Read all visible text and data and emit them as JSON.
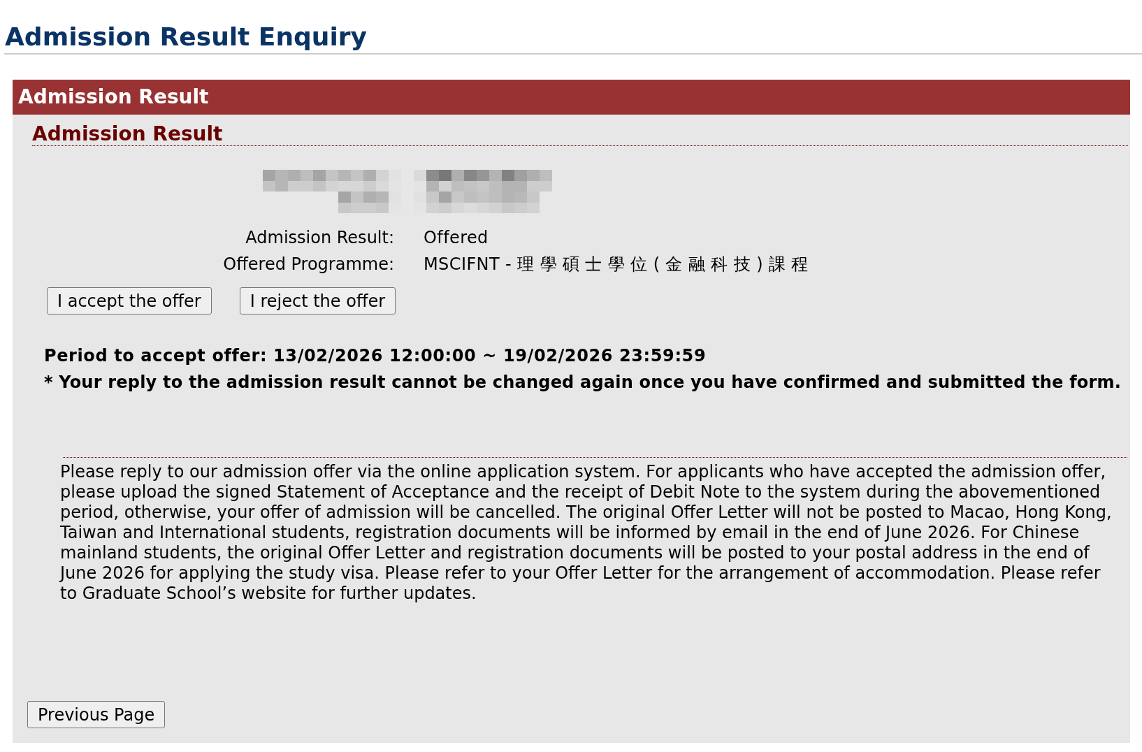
{
  "page_title": "Admission Result Enquiry",
  "panel": {
    "title": "Admission Result",
    "section_heading": "Admission Result",
    "details": [
      {
        "label": "Admission Result:",
        "value": "Offered"
      },
      {
        "label": "Offered Programme:",
        "value": "MSCIFNT - 理 學 碩 士 學 位 ( 金 融 科 技 ) 課 程"
      }
    ],
    "actions": [
      "I accept the offer",
      "I reject the offer"
    ],
    "period": "Period to accept offer: 13/02/2026 12:00:00 ~ 19/02/2026 23:59:59",
    "warning": "* Your reply to the admission result cannot be changed again once you have confirmed and submitted the form.",
    "notice": "Please reply to our admission offer via the online application system. For applicants who have accepted the admission offer, please upload the signed Statement of Acceptance and the receipt of Debit Note to the system during the abovementioned period, otherwise, your offer of admission will be cancelled. The original Offer Letter will not be posted to Macao, Hong Kong, Taiwan and International students, registration documents will be informed by email in the end of June 2026. For Chinese mainland students, the original Offer Letter and registration documents will be posted to your postal address in the end of June 2026 for applying the study visa. Please refer to your Offer Letter for the arrangement of accommodation. Please refer to Graduate School’s website for further updates.",
    "back_button": "Previous Page"
  }
}
